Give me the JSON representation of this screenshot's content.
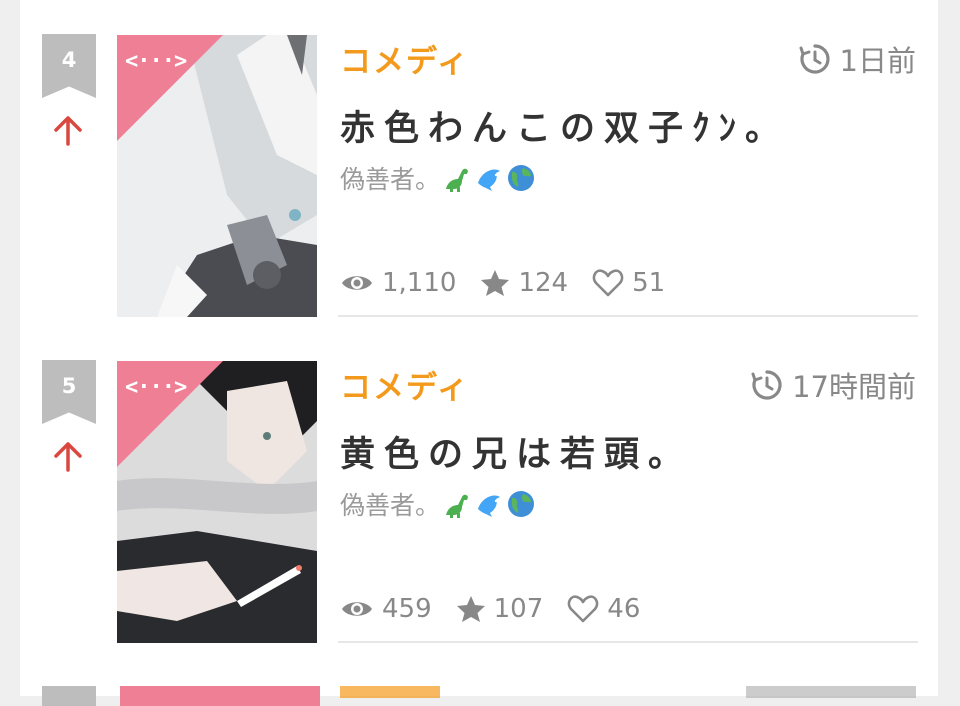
{
  "items": [
    {
      "rank": "4",
      "trend": "up",
      "genre": "コメディ",
      "time": "1日前",
      "title": "赤色わんこの双子ｸﾝ。",
      "author": "偽善者。",
      "emojis": [
        "dinosaur-icon",
        "dolphin-icon",
        "globe-icon"
      ],
      "views": "1,110",
      "stars": "124",
      "likes": "51",
      "corner_glyph": "<···>"
    },
    {
      "rank": "5",
      "trend": "up",
      "genre": "コメディ",
      "time": "17時間前",
      "title": "黄色の兄は若頭。",
      "author": "偽善者。",
      "emojis": [
        "dinosaur-icon",
        "dolphin-icon",
        "globe-icon"
      ],
      "views": "459",
      "stars": "107",
      "likes": "46",
      "corner_glyph": "<···>"
    }
  ],
  "colors": {
    "genre": "#f39a1c",
    "trend_up": "#d9473f",
    "rank_badge": "#bdbdbd",
    "corner_ribbon": "#ee7f94",
    "meta_text": "#888888"
  }
}
